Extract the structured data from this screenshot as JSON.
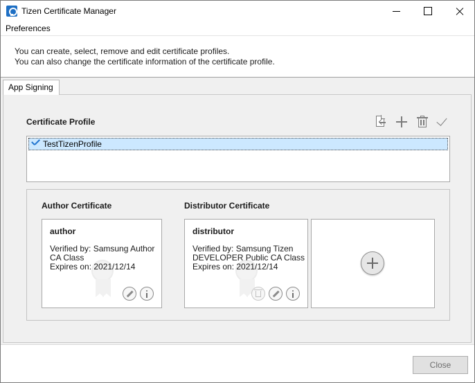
{
  "window": {
    "title": "Tizen Certificate Manager",
    "controls": [
      "minimize",
      "maximize",
      "close"
    ]
  },
  "menu": {
    "items": [
      "Preferences"
    ]
  },
  "description": {
    "line1": "You can create, select, remove and edit certificate profiles.",
    "line2": "You can also change the certificate information of the certificate profile."
  },
  "tabs": [
    {
      "label": "App Signing",
      "selected": true
    }
  ],
  "profile_section": {
    "title": "Certificate Profile",
    "toolbar_icons": [
      "import-icon",
      "plus-icon",
      "trash-icon",
      "check-icon"
    ],
    "profiles": [
      {
        "name": "TestTizenProfile",
        "active": true
      }
    ]
  },
  "author": {
    "title": "Author Certificate",
    "name": "author",
    "verified_line1": "Verified by: Samsung Author",
    "verified_line2": "CA Class",
    "expires": "Expires on: 2021/12/14"
  },
  "distributor": {
    "title": "Distributor Certificate",
    "name": "distributor",
    "verified_line1": "Verified by: Samsung Tizen",
    "verified_line2": "DEVELOPER Public CA Class",
    "expires": "Expires on: 2021/12/14"
  },
  "footer": {
    "close_label": "Close"
  },
  "colors": {
    "selection": "#cce8ff",
    "check_accent": "#1f73cf",
    "panel_bg": "#f0f0f0"
  }
}
